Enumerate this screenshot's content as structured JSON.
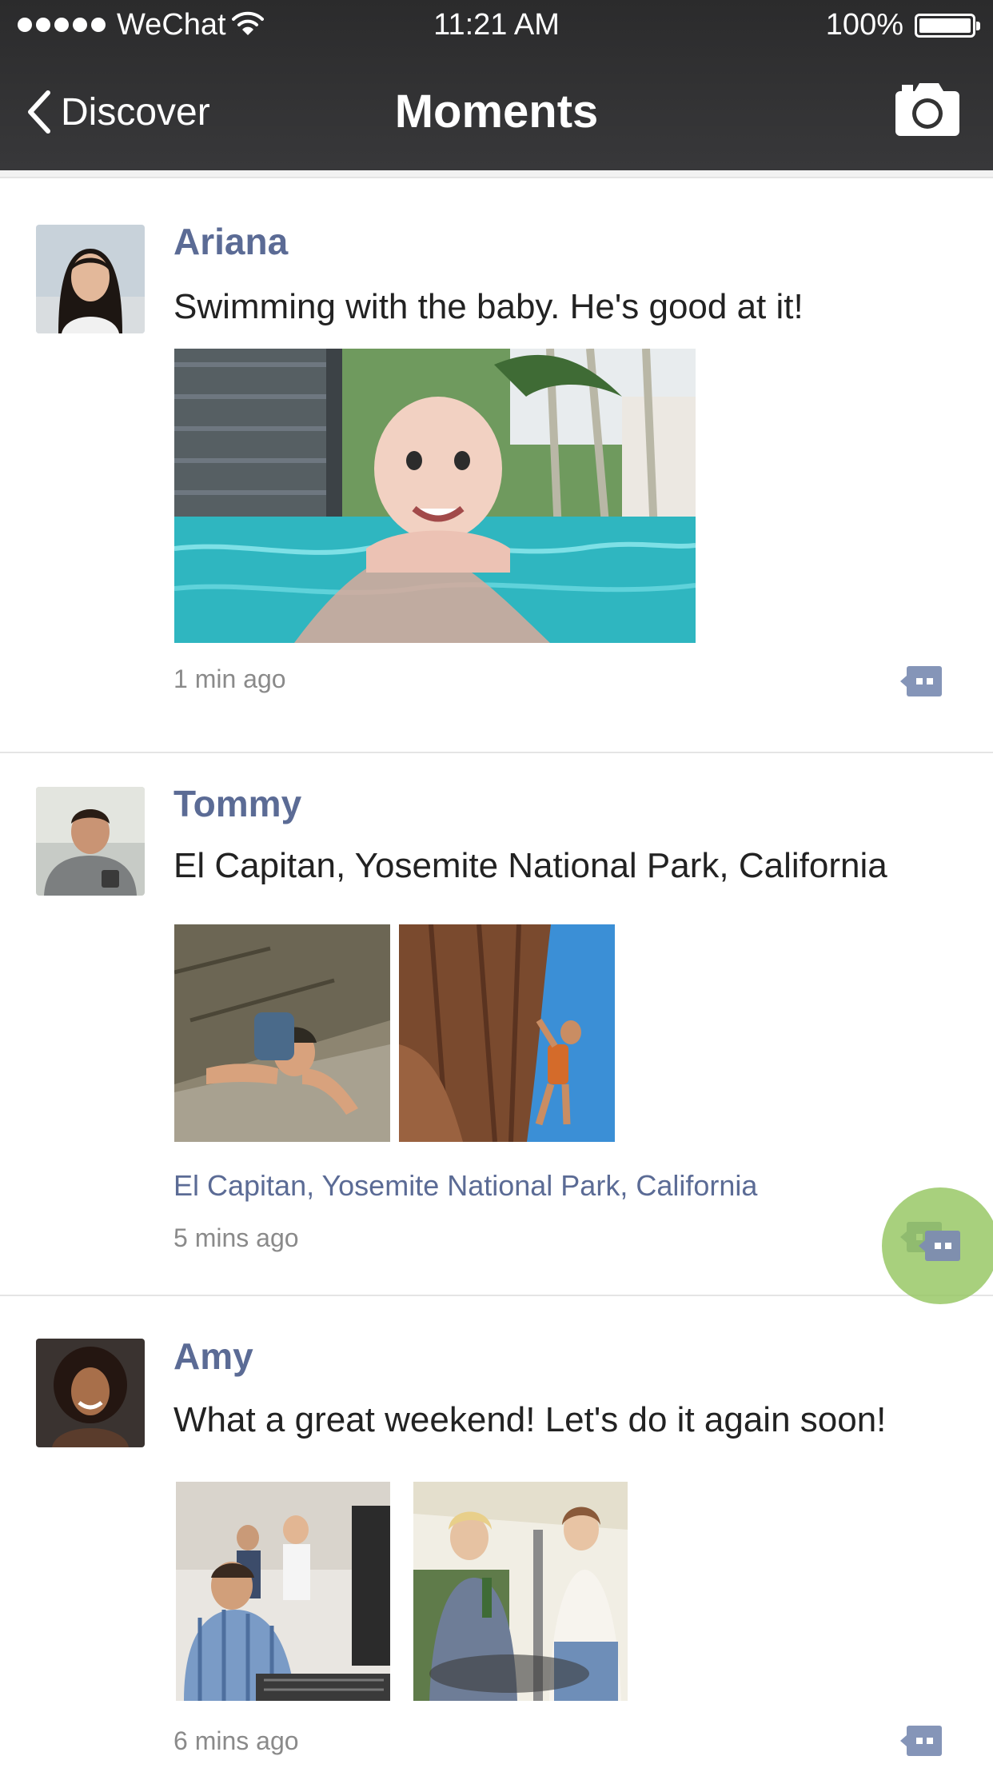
{
  "status_bar": {
    "carrier": "WeChat",
    "time": "11:21 AM",
    "battery": "100%"
  },
  "nav": {
    "back_label": "Discover",
    "title": "Moments"
  },
  "posts": [
    {
      "name": "Ariana",
      "text": "Swimming with the baby. He's good at it!",
      "time": "1 min ago",
      "photos": [
        "baby-swimming-photo"
      ]
    },
    {
      "name": "Tommy",
      "text": "El Capitan, Yosemite National Park, California",
      "location": "El Capitan, Yosemite National Park, California",
      "time": "5 mins ago",
      "photos": [
        "climber-on-rock-photo",
        "climber-on-cliff-photo"
      ]
    },
    {
      "name": "Amy",
      "text": "What a great weekend! Let's do it again soon!",
      "time": "6 mins ago",
      "photos": [
        "barbecue-grill-photo",
        "friends-drinking-photo"
      ]
    }
  ],
  "colors": {
    "link": "#5b6b95",
    "touch_indicator": "#92c45d",
    "navbar": "#2f2f30"
  }
}
